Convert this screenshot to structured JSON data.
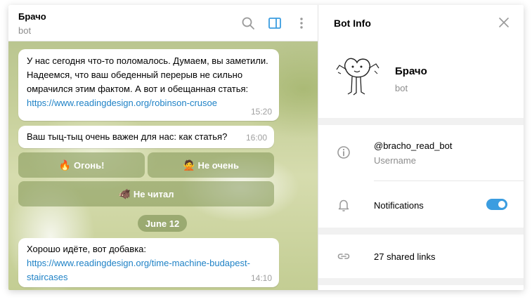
{
  "chat": {
    "title": "Брачо",
    "subtitle": "bot",
    "messages": [
      {
        "text": "У нас сегодня что-то поломалось. Думаем, вы заметили. Надеемся, что ваш обеденный перерыв не сильно омрачился этим фактом. А вот и обещанная статья: ",
        "link": "https://www.readingdesign.org/robinson-crusoe",
        "time": "15:20"
      },
      {
        "text": "Ваш тыц-тыц очень важен для нас: как статья?",
        "time": "16:00"
      },
      {
        "text": "Хорошо идёте, вот добавка:",
        "link": "https://www.readingdesign.org/time-machine-budapest-staircases",
        "time": "14:10"
      }
    ],
    "keyboard": [
      {
        "emoji": "🔥",
        "label": "Огонь!"
      },
      {
        "emoji": "🙅",
        "label": "Не очень"
      },
      {
        "emoji": "🐗",
        "label": "Не читал"
      }
    ],
    "date_separator": "June 12"
  },
  "header_icons": [
    "search-icon",
    "sidebar-toggle-icon",
    "more-vertical-icon"
  ],
  "panel": {
    "title": "Bot Info",
    "bot_name": "Брачо",
    "bot_sub": "bot",
    "username_value": "@bracho_read_bot",
    "username_label": "Username",
    "notifications_label": "Notifications",
    "notifications_on": true,
    "shared_links": "27 shared links"
  },
  "colors": {
    "accent": "#3b9de0",
    "link": "#1f82c6",
    "chat_bg": "#c6cf9a"
  }
}
